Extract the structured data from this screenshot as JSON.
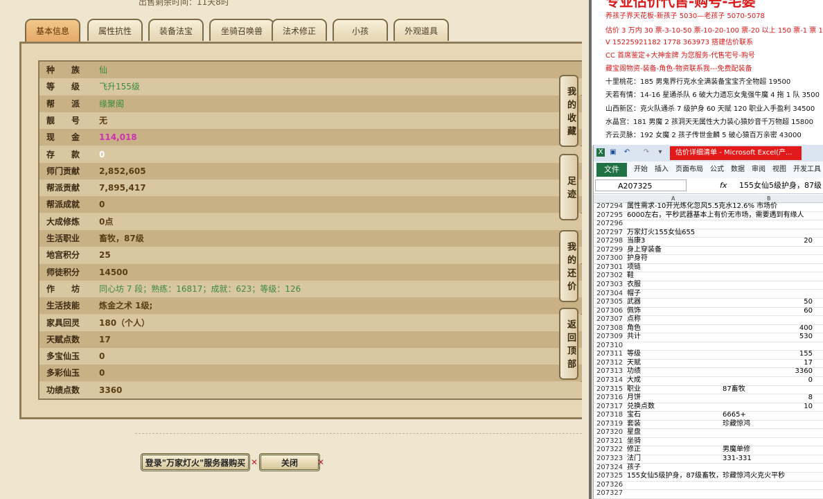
{
  "game": {
    "topline": "出售剩余时间：11天8时",
    "tabs": [
      "基本信息",
      "属性抗性",
      "装备法宝",
      "坐骑召唤兽",
      "法术修正",
      "小孩",
      "外观道具"
    ],
    "rows": [
      {
        "label": "种　　族",
        "value": "仙",
        "color": "green"
      },
      {
        "label": "等　　级",
        "value": "飞升155级",
        "color": "green"
      },
      {
        "label": "帮　　派",
        "value": "缘聚阁",
        "color": "green"
      },
      {
        "label": "靓　　号",
        "value": "无",
        "color": "dark"
      },
      {
        "label": "现　　金",
        "value": "114,018",
        "color": "pink"
      },
      {
        "label": "存　　款",
        "value": "0",
        "color": "white"
      },
      {
        "label": "师门贡献",
        "value": "2,852,605",
        "color": "dark"
      },
      {
        "label": "帮派贡献",
        "value": "7,895,417",
        "color": "dark"
      },
      {
        "label": "帮派成就",
        "value": "0",
        "color": "dark"
      },
      {
        "label": "大成修炼",
        "value": "0点",
        "color": "dark"
      },
      {
        "label": "生活职业",
        "value": "畜牧，87级",
        "color": "dark"
      },
      {
        "label": "地宫积分",
        "value": "25",
        "color": "dark"
      },
      {
        "label": "师徒积分",
        "value": "14500",
        "color": "dark"
      },
      {
        "label": "作　　坊",
        "value": "同心坊 7 段；熟练：16817；成就：623；等级：126",
        "color": "green"
      },
      {
        "label": "生活技能",
        "value": "炼金之术 1级;",
        "color": "dark"
      },
      {
        "label": "家具回灵",
        "value": "180（个人）",
        "color": "dark"
      },
      {
        "label": "天赋点数",
        "value": "17",
        "color": "dark"
      },
      {
        "label": "多宝仙玉",
        "value": "0",
        "color": "dark"
      },
      {
        "label": "多彩仙玉",
        "value": "0",
        "color": "dark"
      },
      {
        "label": "功绩点数",
        "value": "3360",
        "color": "dark"
      }
    ],
    "side_buttons": [
      "我的收藏",
      "足迹",
      "我的还价",
      "返回顶部"
    ],
    "login_button": "登录\"万家灯火\"服务器购买",
    "close_button": "关闭"
  },
  "ad": {
    "headline": "专业估价代售-购号-宅婆",
    "lines": [
      {
        "text": "养孩子界天花板-新孩子 5030—老孩子 5070-5078",
        "cls": "red"
      },
      {
        "text": "估价 3 万内 30 票-3-10-50 票-10-20-100 票-20 以上 150 票-1 票 1",
        "cls": "red"
      },
      {
        "text": "V 15225921182       1778 363973  搭建估价联系",
        "cls": "red"
      },
      {
        "text": "CC 首席鉴定+大神金牌 为您服务-代售宅号-购号",
        "cls": "red"
      },
      {
        "text": "藏宝阁物资-装备-角色-物资联系我---免费配装备",
        "cls": "red"
      },
      {
        "text": "十里桃花：185 男鬼界行克水全满装备宝宝齐全物超 19500",
        "cls": "blk"
      },
      {
        "text": "天若有情：14-16 星通杀队 6 破大力遗忘女鬼强牛魔 4 拖 1 队 3500",
        "cls": "blk"
      },
      {
        "text": "山西新区：克火队通杀 7 级护身 60 天赋 120 职业入手盈利 34500",
        "cls": "blk"
      },
      {
        "text": "水晶宫：181 男魔 2 孩洞天无属性大力装心猿妙音千万物超 15800",
        "cls": "blk"
      },
      {
        "text": "齐云灵脉：192 女魔 2 孩子传世金麟 5 破心猿百万亲密 43000",
        "cls": "blk"
      }
    ]
  },
  "excel": {
    "title": "估价详细清单 - Microsoft Excel(产...",
    "file_tab": "文件",
    "ribbon_tabs": [
      "开始",
      "插入",
      "页面布局",
      "公式",
      "数据",
      "审阅",
      "视图",
      "开发工具"
    ],
    "name_box": "A207325",
    "fx": "fx",
    "formula": "155女仙5级护身，87级",
    "col_a": "A",
    "col_b": "B",
    "rows": [
      {
        "n": "207294",
        "a": "属性需求-10开光炼化忽风5.5克水12.6% 市场价",
        "b": ""
      },
      {
        "n": "207295",
        "a": "6000左右，平秒武器基本上有价无市场，需要遇到有缘人",
        "b": ""
      },
      {
        "n": "207296",
        "a": "",
        "b": ""
      },
      {
        "n": "207297",
        "a": "万家灯火155女仙655",
        "b": ""
      },
      {
        "n": "207298",
        "a": "当康3",
        "b": "20"
      },
      {
        "n": "207299",
        "a": "身上穿装备",
        "b": ""
      },
      {
        "n": "207300",
        "a": "护身符",
        "b": ""
      },
      {
        "n": "207301",
        "a": "项链",
        "b": ""
      },
      {
        "n": "207302",
        "a": "鞋",
        "b": ""
      },
      {
        "n": "207303",
        "a": "衣服",
        "b": ""
      },
      {
        "n": "207304",
        "a": "帽子",
        "b": ""
      },
      {
        "n": "207305",
        "a": "武器",
        "b": "50"
      },
      {
        "n": "207306",
        "a": "佩饰",
        "b": "60"
      },
      {
        "n": "207307",
        "a": "点称",
        "b": ""
      },
      {
        "n": "207308",
        "a": "角色",
        "b": "400"
      },
      {
        "n": "207309",
        "a": "共计",
        "b": "530"
      },
      {
        "n": "207310",
        "a": "",
        "b": ""
      },
      {
        "n": "207311",
        "a": "等级",
        "b": "155"
      },
      {
        "n": "207312",
        "a": "天赋",
        "b": "17"
      },
      {
        "n": "207313",
        "a": "功绩",
        "b": "3360"
      },
      {
        "n": "207314",
        "a": "大成",
        "b": "0"
      },
      {
        "n": "207315",
        "a": "职业",
        "b": "87畜牧",
        "btext": true
      },
      {
        "n": "207316",
        "a": "月饼",
        "b": "8"
      },
      {
        "n": "207317",
        "a": "兑换点数",
        "b": "10"
      },
      {
        "n": "207318",
        "a": "宝石",
        "b": "6665+",
        "btext": true
      },
      {
        "n": "207319",
        "a": "套装",
        "b": "珍藏惊鸿",
        "btext": true
      },
      {
        "n": "207320",
        "a": "星盘",
        "b": ""
      },
      {
        "n": "207321",
        "a": "坐骑",
        "b": ""
      },
      {
        "n": "207322",
        "a": "修正",
        "b": "男魔单修",
        "btext": true
      },
      {
        "n": "207323",
        "a": "法门",
        "b": "331-331",
        "btext": true
      },
      {
        "n": "207324",
        "a": "孩子",
        "b": ""
      },
      {
        "n": "207325",
        "a": "155女仙5级护身，87级畜牧，珍藏惊鸿火克火平秒",
        "b": ""
      },
      {
        "n": "207326",
        "a": "",
        "b": ""
      },
      {
        "n": "207327",
        "a": "",
        "b": ""
      }
    ]
  }
}
